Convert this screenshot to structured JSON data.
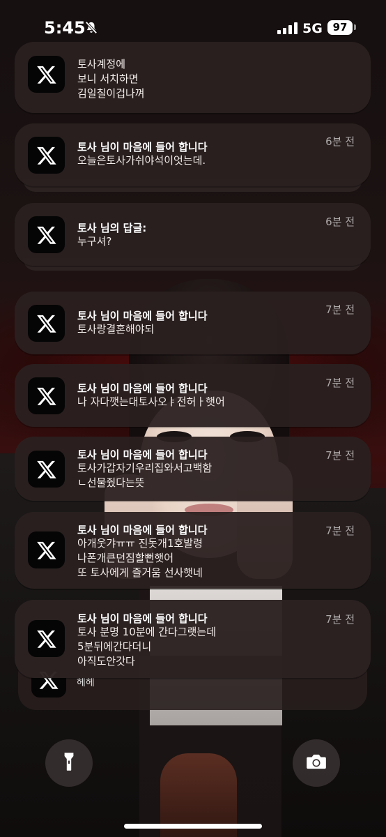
{
  "status_bar": {
    "time": "5:45",
    "network": "5G",
    "battery": "97"
  },
  "notifications": [
    {
      "title": "",
      "body": "토사계정에\n보니 서치하면\n김일칠이겁나껴",
      "time": ""
    },
    {
      "title": "토사 님이 마음에 들어 합니다",
      "body": "오늘은토사가쉬야석이엇는데.",
      "time": "6분 전"
    },
    {
      "title": "토사 님의 답글:",
      "body": "누구셔?",
      "time": "6분 전"
    },
    {
      "title": "토사 님이 마음에 들어 합니다",
      "body": "토사랑결혼해야되",
      "time": "7분 전"
    },
    {
      "title": "토사 님이 마음에 들어 합니다",
      "body": "나 자다깻는대토사오ㅑ전허ㅏ햇어",
      "time": "7분 전"
    },
    {
      "title": "토사 님이 마음에 들어 합니다",
      "body": "토사가갑자기우리집와서고백함\nㄴ선물줬다는뜻",
      "time": "7분 전"
    },
    {
      "title": "토사 님이 마음에 들어 합니다",
      "body": "아개웃갸ㅠㅠ 진돗개1호발령\n나폰개큰던짐할뻔햇어\n또 토사에게 즐거움 선사햇네",
      "time": "7분 전"
    },
    {
      "title": "토사 님이 마음에 들어 합니다",
      "body": "토사 분명 10분에 간다그랫는데\n5분뒤에간다더니\n아직도안갓다",
      "time": "7분 전"
    }
  ],
  "peek": {
    "body": "헤헤"
  },
  "icons": {
    "app": "x-logo-icon",
    "silent": "bell-slash-icon",
    "flashlight": "flashlight-icon",
    "camera": "camera-icon"
  }
}
